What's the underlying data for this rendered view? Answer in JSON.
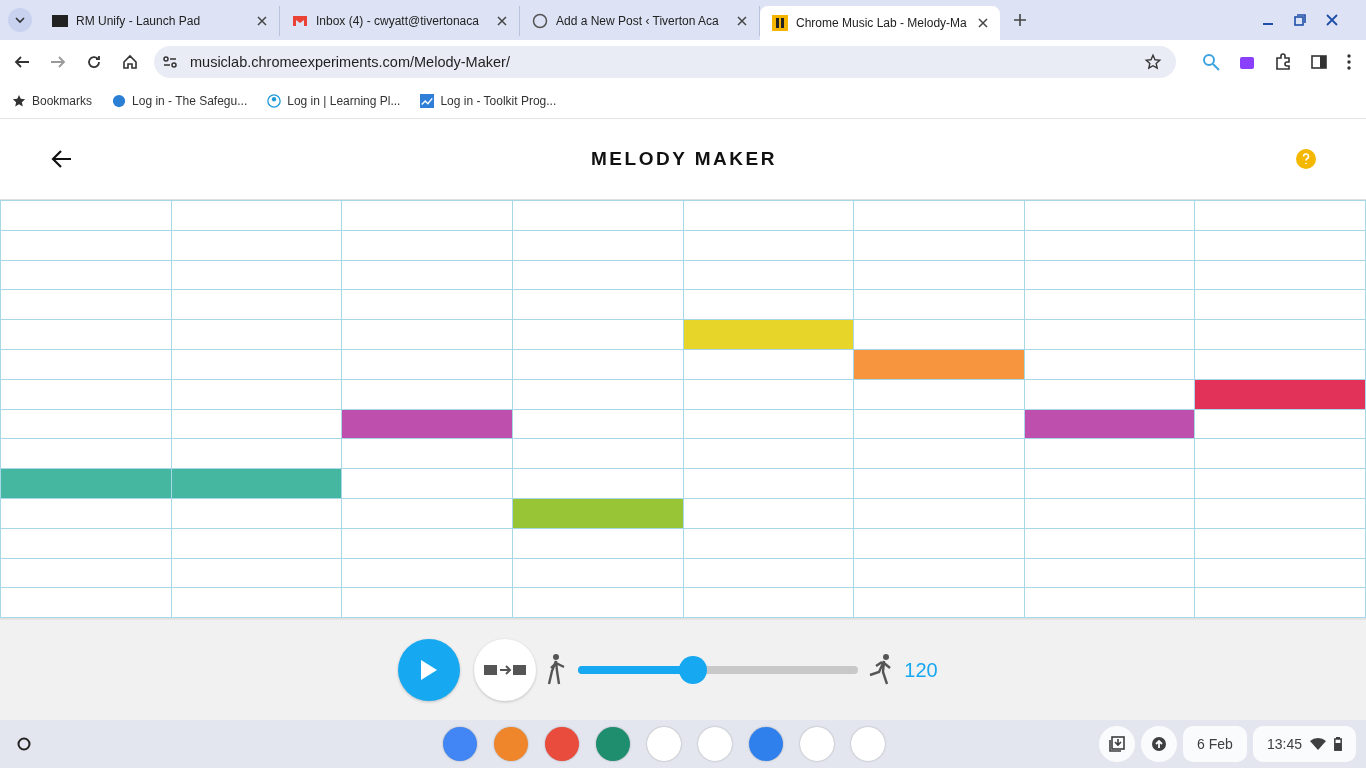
{
  "browser": {
    "tabs": [
      {
        "title": "RM Unify - Launch Pad",
        "kind": "rm",
        "selected": false
      },
      {
        "title": "Inbox (4) - cwyatt@tivertonaca",
        "kind": "mail",
        "selected": false
      },
      {
        "title": "Add a New Post ‹ Tiverton Aca",
        "kind": "wp",
        "selected": false
      },
      {
        "title": "Chrome Music Lab - Melody-Ma",
        "kind": "cml",
        "selected": true
      }
    ],
    "url": "musiclab.chromeexperiments.com/Melody-Maker/",
    "bookmarks": [
      {
        "label": "Bookmarks",
        "kind": "star"
      },
      {
        "label": "Log in - The Safegu...",
        "kind": "globe"
      },
      {
        "label": "Log in | Learning Pl...",
        "kind": "person"
      },
      {
        "label": "Log in - Toolkit Prog...",
        "kind": "chart"
      }
    ]
  },
  "app": {
    "title": "MELODY MAKER",
    "grid": {
      "rows": [
        {
          "cells": [
            {
              "on": false
            },
            {
              "on": false
            },
            {
              "on": false
            },
            {
              "on": false
            },
            {
              "on": false
            },
            {
              "on": false
            },
            {
              "on": false
            },
            {
              "on": false
            }
          ]
        },
        {
          "cells": [
            {
              "on": false
            },
            {
              "on": false
            },
            {
              "on": false
            },
            {
              "on": false
            },
            {
              "on": false
            },
            {
              "on": false
            },
            {
              "on": false
            },
            {
              "on": false
            }
          ]
        },
        {
          "cells": [
            {
              "on": false
            },
            {
              "on": false
            },
            {
              "on": false
            },
            {
              "on": false
            },
            {
              "on": false
            },
            {
              "on": false
            },
            {
              "on": false
            },
            {
              "on": false
            }
          ]
        },
        {
          "cells": [
            {
              "on": false
            },
            {
              "on": false
            },
            {
              "on": false
            },
            {
              "on": false
            },
            {
              "on": false
            },
            {
              "on": false
            },
            {
              "on": false
            },
            {
              "on": false
            }
          ]
        },
        {
          "cells": [
            {
              "on": false
            },
            {
              "on": false
            },
            {
              "on": false
            },
            {
              "on": false
            },
            {
              "on": true,
              "color": "#e8d52a"
            },
            {
              "on": false
            },
            {
              "on": false
            },
            {
              "on": false
            }
          ]
        },
        {
          "cells": [
            {
              "on": false
            },
            {
              "on": false
            },
            {
              "on": false
            },
            {
              "on": false
            },
            {
              "on": false
            },
            {
              "on": true,
              "color": "#f7943e"
            },
            {
              "on": false
            },
            {
              "on": false
            }
          ]
        },
        {
          "cells": [
            {
              "on": false
            },
            {
              "on": false
            },
            {
              "on": false
            },
            {
              "on": false
            },
            {
              "on": false
            },
            {
              "on": false
            },
            {
              "on": false
            },
            {
              "on": true,
              "color": "#e3325a"
            }
          ]
        },
        {
          "cells": [
            {
              "on": false
            },
            {
              "on": false
            },
            {
              "on": true,
              "color": "#bf4fad"
            },
            {
              "on": false
            },
            {
              "on": false
            },
            {
              "on": false
            },
            {
              "on": true,
              "color": "#bf4fad"
            },
            {
              "on": false
            }
          ]
        },
        {
          "cells": [
            {
              "on": false
            },
            {
              "on": false
            },
            {
              "on": false
            },
            {
              "on": false
            },
            {
              "on": false
            },
            {
              "on": false
            },
            {
              "on": false
            },
            {
              "on": false
            }
          ]
        },
        {
          "cells": [
            {
              "on": true,
              "color": "#45b6a0"
            },
            {
              "on": true,
              "color": "#45b6a0"
            },
            {
              "on": false
            },
            {
              "on": false
            },
            {
              "on": false
            },
            {
              "on": false
            },
            {
              "on": false
            },
            {
              "on": false
            }
          ]
        },
        {
          "cells": [
            {
              "on": false
            },
            {
              "on": false
            },
            {
              "on": false
            },
            {
              "on": true,
              "color": "#98c536"
            },
            {
              "on": false
            },
            {
              "on": false
            },
            {
              "on": false
            },
            {
              "on": false
            }
          ]
        },
        {
          "cells": [
            {
              "on": false
            },
            {
              "on": false
            },
            {
              "on": false
            },
            {
              "on": false
            },
            {
              "on": false
            },
            {
              "on": false
            },
            {
              "on": false
            },
            {
              "on": false
            }
          ]
        },
        {
          "cells": [
            {
              "on": false
            },
            {
              "on": false
            },
            {
              "on": false
            },
            {
              "on": false
            },
            {
              "on": false
            },
            {
              "on": false
            },
            {
              "on": false
            },
            {
              "on": false
            }
          ]
        },
        {
          "cells": [
            {
              "on": false
            },
            {
              "on": false
            },
            {
              "on": false
            },
            {
              "on": false
            },
            {
              "on": false
            },
            {
              "on": false
            },
            {
              "on": false
            },
            {
              "on": false
            }
          ]
        }
      ]
    },
    "tempo": {
      "level": 0.4,
      "reading": "120"
    }
  },
  "shelf": {
    "date": "6 Feb",
    "time": "13:45"
  }
}
